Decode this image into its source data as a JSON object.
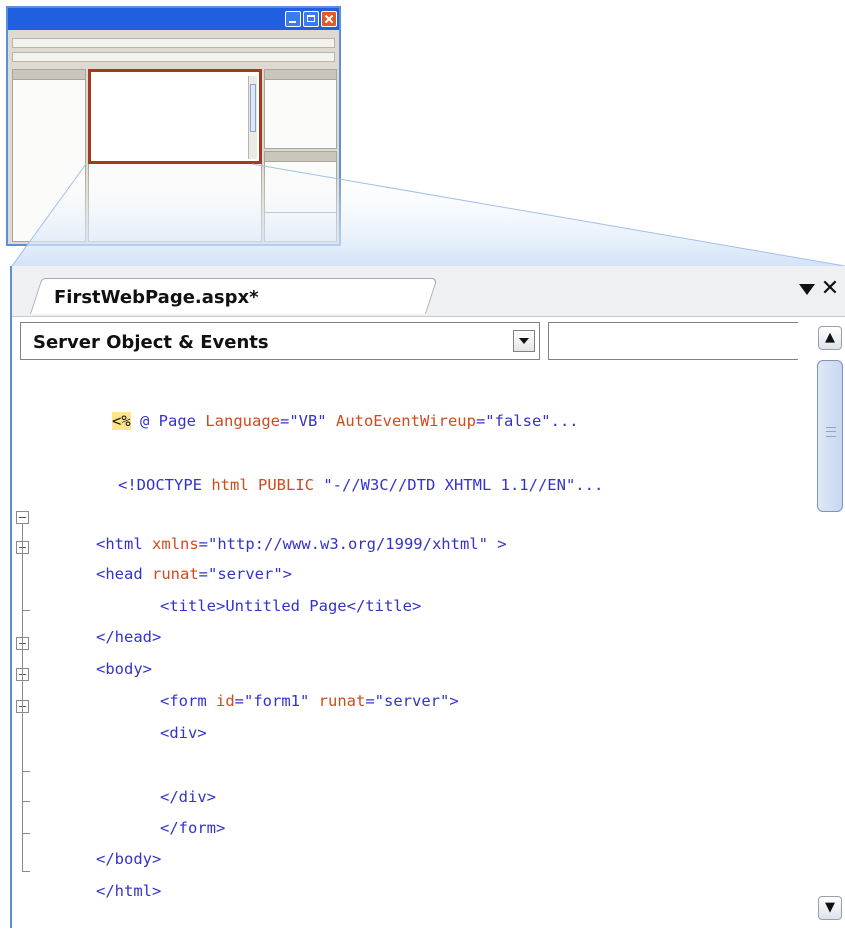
{
  "editor": {
    "tab_title": "FirstWebPage.aspx*",
    "object_selector": "Server Object & Events",
    "event_selector": ""
  },
  "icons": {
    "tab_menu": "triangle-down-icon",
    "tab_close": "close-icon",
    "dropdown": "chevron-down-icon",
    "scroll_up": "chevron-up-icon",
    "scroll_down": "chevron-down-icon",
    "fold": "collapse-minus-icon"
  },
  "colors": {
    "keyword_blue": "#3333cc",
    "attribute_red": "#d04a1e",
    "highlight": "#ffe58a",
    "window_blue": "#1f5fe0",
    "focus_red": "#a33a1c"
  },
  "code": {
    "l1_hl": "<%",
    "l1_a": " @ Page ",
    "l1_b": "Language",
    "l1_c": "=\"VB\" ",
    "l1_d": "AutoEventWireup",
    "l1_e": "=\"false\"...",
    "l2_a": "<!DOCTYPE ",
    "l2_b": "html PUBLIC",
    "l2_c": " \"-//W3C//DTD XHTML 1.1//EN\"...",
    "l3_a": "<html ",
    "l3_b": "xmlns",
    "l3_c": "=\"http://www.w3.org/1999/xhtml\" >",
    "l4_a": "<head ",
    "l4_b": "runat",
    "l4_c": "=\"server\">",
    "l5_a": "<title>Untitled Page</title>",
    "l6_a": "</head>",
    "l7_a": "<body>",
    "l8_a": "<form ",
    "l8_b": "id",
    "l8_c": "=\"form1\" ",
    "l8_d": "runat",
    "l8_e": "=\"server\">",
    "l9_a": "<div>",
    "l10_a": "</div>",
    "l11_a": "</form>",
    "l12_a": "</body>",
    "l13_a": "</html>"
  }
}
